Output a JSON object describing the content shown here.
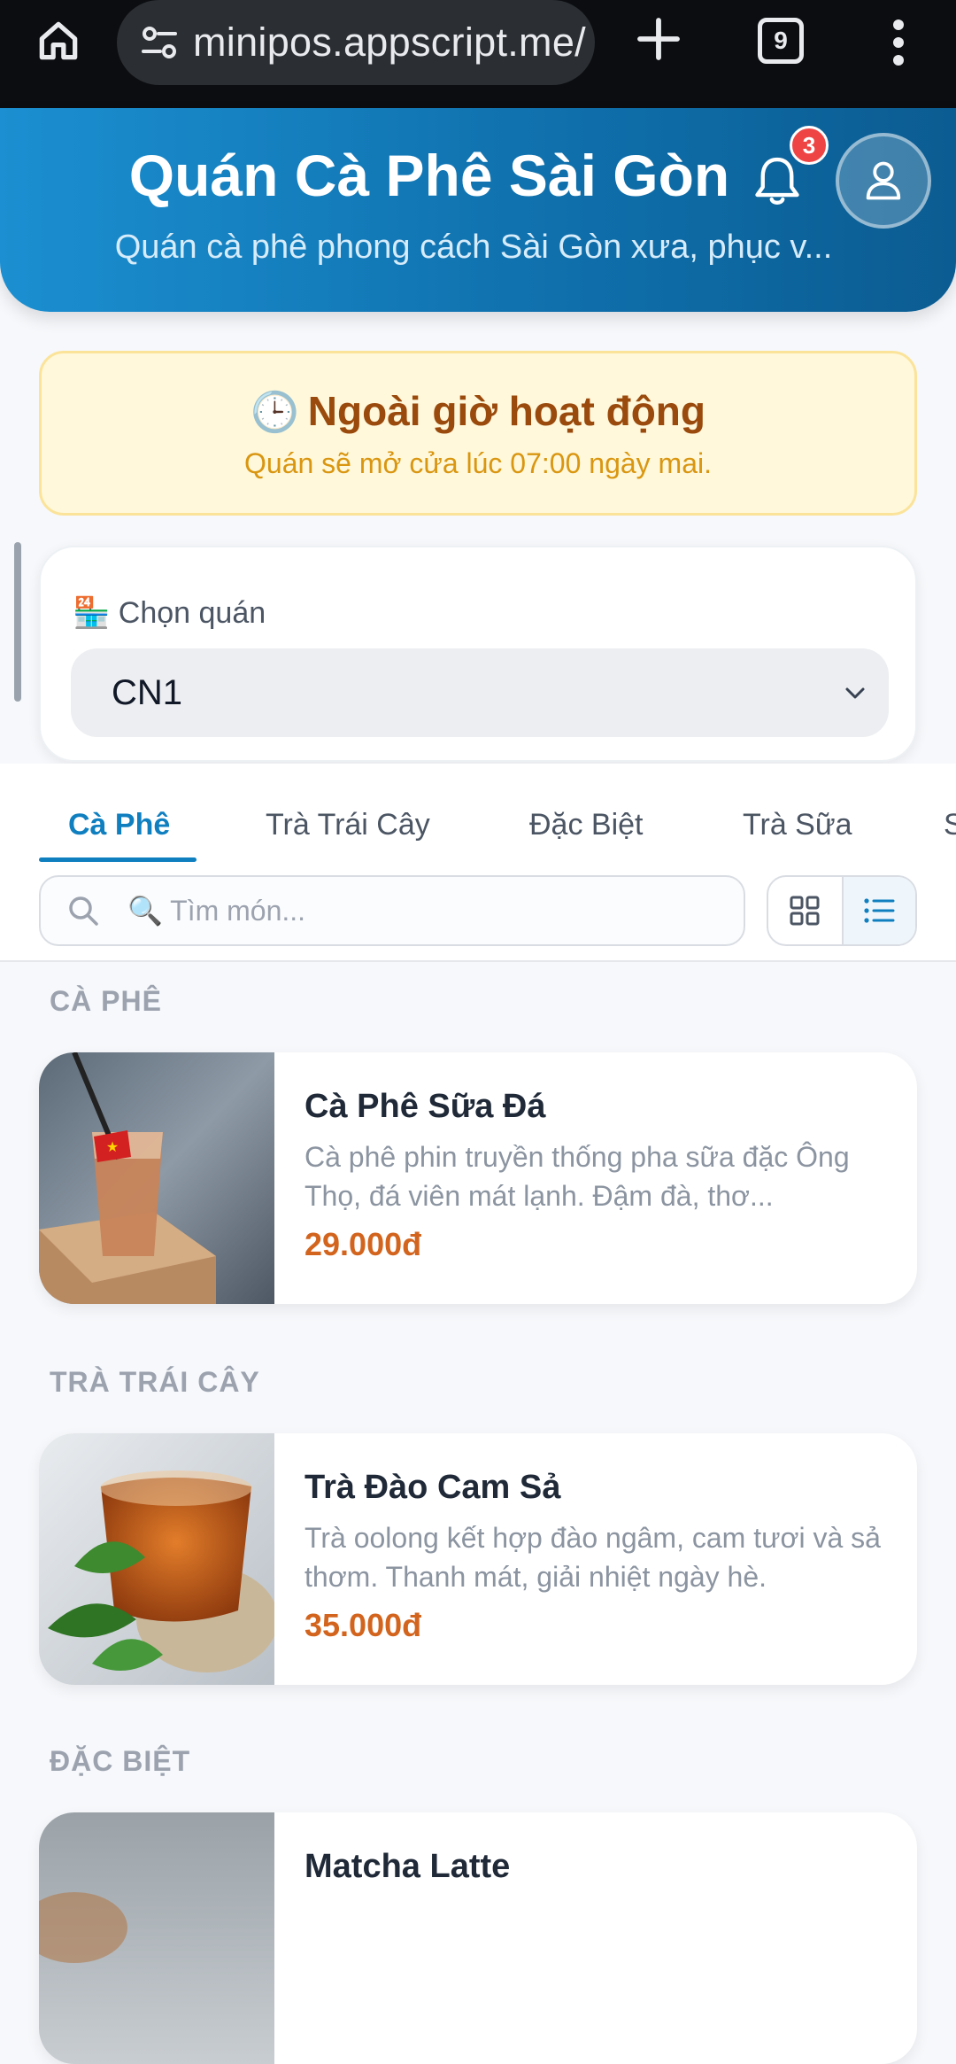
{
  "browser": {
    "url": "minipos.appscript.me/",
    "tab_count": "9"
  },
  "header": {
    "title": "Quán Cà Phê Sài Gòn",
    "subtitle": "Quán cà phê phong cách Sài Gòn xưa, phục v...",
    "notification_count": "3"
  },
  "status_banner": {
    "icon": "🕒",
    "heading": "Ngoài giờ hoạt động",
    "message": "Quán sẽ mở cửa lúc 07:00 ngày mai."
  },
  "store_select": {
    "icon": "🏪",
    "label": "Chọn quán",
    "selected": "CN1"
  },
  "category_tabs": [
    {
      "label": "Cà Phê",
      "active": true
    },
    {
      "label": "Trà Trái Cây",
      "active": false
    },
    {
      "label": "Đặc Biệt",
      "active": false
    },
    {
      "label": "Trà Sữa",
      "active": false
    },
    {
      "label": "S",
      "active": false
    }
  ],
  "search": {
    "placeholder": "🔍 Tìm món..."
  },
  "sections": [
    {
      "title": "CÀ PHÊ",
      "items": [
        {
          "name": "Cà Phê Sữa Đá",
          "description": "Cà phê phin truyền thống pha sữa đặc Ông Thọ, đá viên mát lạnh. Đậm đà, thơ...",
          "price": "29.000đ"
        }
      ]
    },
    {
      "title": "TRÀ TRÁI CÂY",
      "items": [
        {
          "name": "Trà Đào Cam Sả",
          "description": "Trà oolong kết hợp đào ngâm, cam tươi và sả thơm. Thanh mát, giải nhiệt ngày hè.",
          "price": "35.000đ"
        }
      ]
    },
    {
      "title": "ĐẶC BIỆT",
      "items": [
        {
          "name": "Matcha Latte",
          "description": "",
          "price": ""
        }
      ]
    }
  ],
  "colors": {
    "brand": "#0f7fc0",
    "price": "#d2641e",
    "banner_bg": "#fff8db"
  }
}
